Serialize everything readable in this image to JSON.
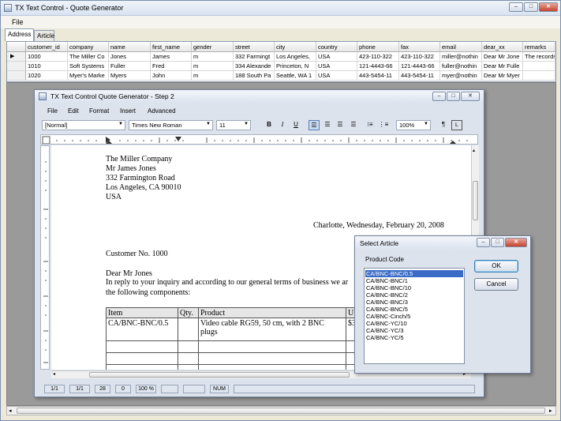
{
  "main": {
    "title": "TX Text Control - Quote Generator",
    "menu": [
      "File"
    ],
    "tabs": [
      "Address",
      "Article"
    ],
    "active_tab": "Address"
  },
  "grid": {
    "columns": [
      "customer_id",
      "company",
      "name",
      "first_name",
      "gender",
      "street",
      "city",
      "country",
      "phone",
      "fax",
      "email",
      "dear_xx",
      "remarks"
    ],
    "rows": [
      [
        "1000",
        "The Miller Co",
        "Jones",
        "James",
        "m",
        "332 Farmingt",
        "Los Angeles,",
        "USA",
        "423-110-322",
        "423-110-322",
        "miller@nothin",
        "Dear Mr Jone",
        "The records"
      ],
      [
        "1010",
        "Soft Systems",
        "Fuller",
        "Fred",
        "m",
        "334 Alexande",
        "Princeton, N",
        "USA",
        "121-4443-66",
        "121-4443-66",
        "fuller@nothin",
        "Dear Mr Fulle",
        ""
      ],
      [
        "1020",
        "Myer's Marke",
        "Myers",
        "John",
        "m",
        "188 South Pa",
        "Seattle, WA 1",
        "USA",
        "443-5454-11",
        "443-5454-11",
        "myer@nothin",
        "Dear Mr Myer",
        ""
      ]
    ]
  },
  "step2": {
    "title": "TX Text Control Quote Generator - Step 2",
    "menu": [
      "File",
      "Edit",
      "Format",
      "Insert",
      "Advanced"
    ],
    "style_select": "[Normal]",
    "font_select": "Times New Roman",
    "size_select": "11",
    "bold": "B",
    "italic": "I",
    "underline": "U",
    "zoom": "100%",
    "doc": {
      "lines": [
        "The Miller Company",
        "Mr James Jones",
        "332 Farmington Road",
        "Los Angeles, CA 90010",
        "USA"
      ],
      "date_line": "Charlotte, Wednesday, February 20, 2008",
      "customer_no": "Customer No. 1000",
      "salutation": "Dear Mr Jones",
      "body1": "In reply to your inquiry and according to our general terms of business we ar",
      "body2": "the following components:",
      "table_headers": [
        "Item",
        "Qty.",
        "Product",
        "U"
      ],
      "table_row": [
        "CA/BNC-BNC/0.5",
        "",
        "Video cable RG59, 50 cm, with 2 BNC",
        "$3"
      ],
      "table_row_cont": "plugs"
    },
    "status": [
      "1/1",
      "1/1",
      "28",
      "0",
      "100 %",
      "",
      "",
      "NUM",
      ""
    ]
  },
  "select_article": {
    "title": "Select Article",
    "label": "Product Code",
    "items": [
      "CA/BNC-BNC/0.5",
      "CA/BNC-BNC/1",
      "CA/BNC-BNC/10",
      "CA/BNC-BNC/2",
      "CA/BNC-BNC/3",
      "CA/BNC-BNC/5",
      "CA/BNC-Cinch/5",
      "CA/BNC-YC/10",
      "CA/BNC-YC/3",
      "CA/BNC-YC/5"
    ],
    "selected_index": 0,
    "ok": "OK",
    "cancel": "Cancel"
  }
}
